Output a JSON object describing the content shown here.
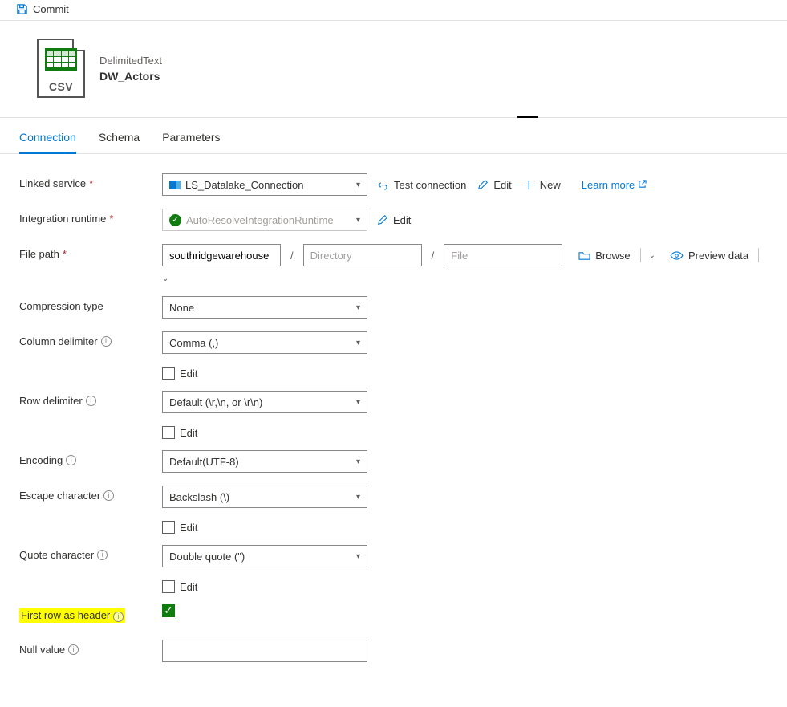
{
  "topbar": {
    "commit": "Commit"
  },
  "header": {
    "datasetType": "DelimitedText",
    "datasetName": "DW_Actors",
    "iconText": "CSV"
  },
  "tabs": {
    "connection": "Connection",
    "schema": "Schema",
    "parameters": "Parameters"
  },
  "labels": {
    "linkedService": "Linked service",
    "integrationRuntime": "Integration runtime",
    "filePath": "File path",
    "compressionType": "Compression type",
    "columnDelimiter": "Column delimiter",
    "rowDelimiter": "Row delimiter",
    "encoding": "Encoding",
    "escapeChar": "Escape character",
    "quoteChar": "Quote character",
    "firstRowHeader": "First row as header",
    "nullValue": "Null value"
  },
  "values": {
    "linkedService": "LS_Datalake_Connection",
    "integrationRuntime": "AutoResolveIntegrationRuntime",
    "container": "southridgewarehouse",
    "directoryPlaceholder": "Directory",
    "filePlaceholder": "File",
    "compressionType": "None",
    "columnDelimiter": "Comma (,)",
    "rowDelimiter": "Default (\\r,\\n, or \\r\\n)",
    "encoding": "Default(UTF-8)",
    "escapeChar": "Backslash (\\)",
    "quoteChar": "Double quote (\")",
    "nullValue": ""
  },
  "actions": {
    "testConnection": "Test connection",
    "edit": "Edit",
    "new": "New",
    "learnMore": "Learn more",
    "browse": "Browse",
    "previewData": "Preview data",
    "editCheckbox": "Edit"
  }
}
